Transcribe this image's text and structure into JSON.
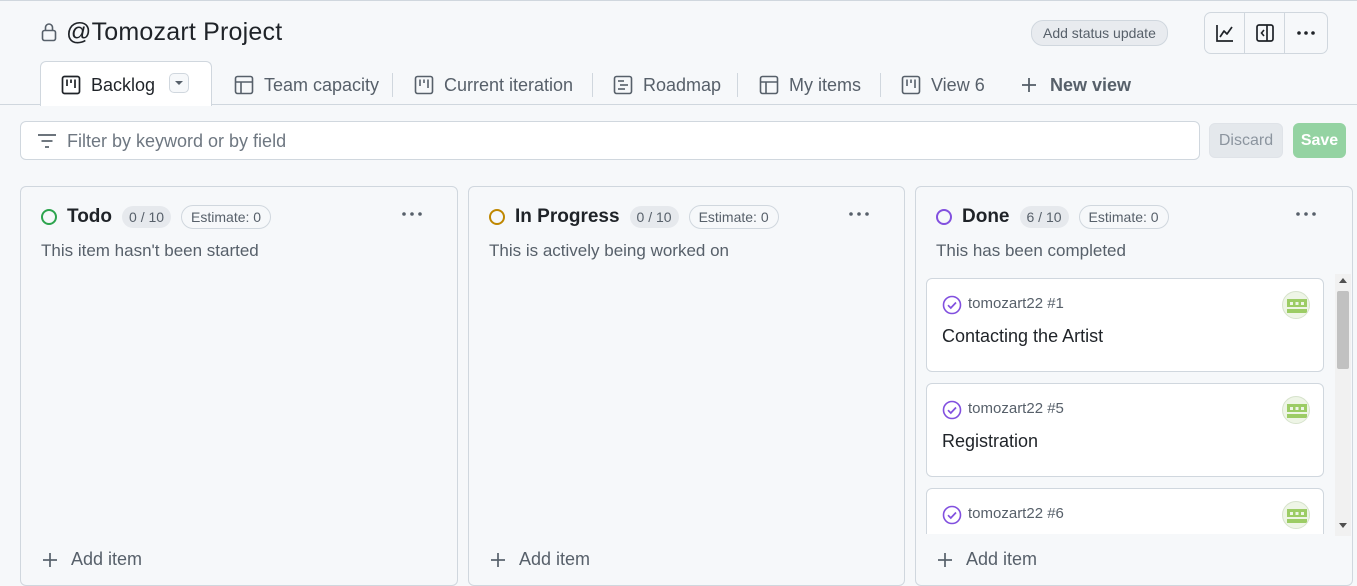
{
  "project": {
    "title": "@Tomozart Project"
  },
  "header": {
    "status_button": "Add status update",
    "icons": [
      "insights-icon",
      "side-panel-icon",
      "more-options-icon"
    ]
  },
  "tabs": [
    {
      "label": "Backlog",
      "icon": "board-icon",
      "active": true
    },
    {
      "label": "Team capacity",
      "icon": "table-icon"
    },
    {
      "label": "Current iteration",
      "icon": "board-icon"
    },
    {
      "label": "Roadmap",
      "icon": "roadmap-icon"
    },
    {
      "label": "My items",
      "icon": "table-icon"
    },
    {
      "label": "View 6",
      "icon": "board-icon"
    }
  ],
  "new_view": "New view",
  "filter": {
    "placeholder": "Filter by keyword or by field",
    "value": ""
  },
  "actions": {
    "discard": "Discard",
    "save": "Save"
  },
  "colors": {
    "todo": "#2da44e",
    "in_progress": "#bf8700",
    "done": "#8250df",
    "save_bg": "#94d3a2"
  },
  "columns": [
    {
      "title": "Todo",
      "count": "0 / 10",
      "estimate": "Estimate: 0",
      "description": "This item hasn't been started",
      "add": "Add item",
      "cards": []
    },
    {
      "title": "In Progress",
      "count": "0 / 10",
      "estimate": "Estimate: 0",
      "description": "This is actively being worked on",
      "add": "Add item",
      "cards": []
    },
    {
      "title": "Done",
      "count": "6 / 10",
      "estimate": "Estimate: 0",
      "description": "This has been completed",
      "add": "Add item",
      "cards": [
        {
          "meta": "tomozart22 #1",
          "title": "Contacting the Artist"
        },
        {
          "meta": "tomozart22 #5",
          "title": "Registration"
        },
        {
          "meta": "tomozart22 #6",
          "title": ""
        }
      ]
    }
  ]
}
